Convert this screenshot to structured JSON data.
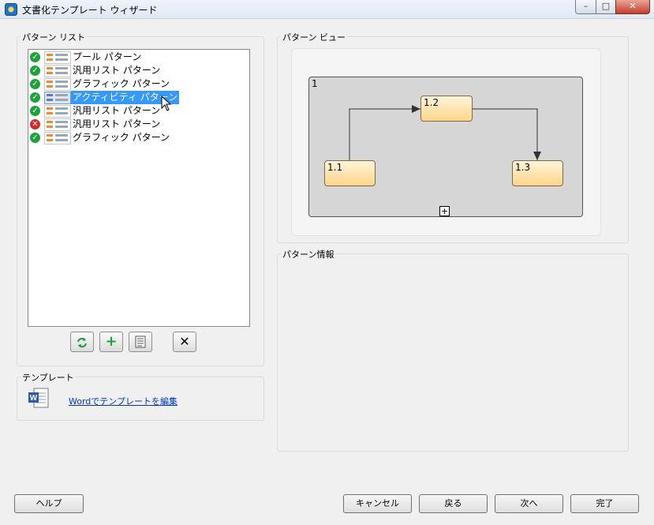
{
  "window": {
    "title": "文書化テンプレート ウィザード",
    "controls": {
      "minimize": "–",
      "maximize": "□",
      "close": "✕"
    }
  },
  "pattern_list": {
    "label": "パターン リスト",
    "items": [
      {
        "label": "プール パターン",
        "status": "ok",
        "icon": "pool-pattern-icon",
        "selected": false
      },
      {
        "label": "汎用リスト パターン",
        "status": "ok",
        "icon": "list-pattern-icon",
        "selected": false
      },
      {
        "label": "グラフィック パターン",
        "status": "ok",
        "icon": "graphic-pattern-icon",
        "selected": false
      },
      {
        "label": "アクティビティ パターン",
        "status": "ok",
        "icon": "activity-pattern-icon",
        "selected": true
      },
      {
        "label": "汎用リスト パターン",
        "status": "ok",
        "icon": "list-pattern-icon",
        "selected": false
      },
      {
        "label": "汎用リスト パターン",
        "status": "error",
        "icon": "list-pattern-icon",
        "selected": false
      },
      {
        "label": "グラフィック パターン",
        "status": "ok",
        "icon": "graphic-pattern-icon",
        "selected": false
      }
    ],
    "toolbar": [
      "refresh-icon",
      "add-icon",
      "properties-icon",
      "delete-icon"
    ]
  },
  "template": {
    "label": "テンプレート",
    "edit_link": "Wordでテンプレートを編集",
    "icon": "word-document-icon"
  },
  "pattern_view": {
    "label": "パターン ビュー",
    "container_label": "1",
    "nodes": [
      "1.1",
      "1.2",
      "1.3"
    ],
    "expand_symbol": "+"
  },
  "pattern_info": {
    "label": "パターン情報"
  },
  "buttons": {
    "help": "ヘルプ",
    "cancel": "キャンセル",
    "back": "戻る",
    "next": "次へ",
    "finish": "完了"
  },
  "colors": {
    "selection": "#3399ff",
    "status_ok": "#1aa33a",
    "status_error": "#d42828",
    "node_fill": "#ffd68a",
    "link": "#0033cc"
  }
}
